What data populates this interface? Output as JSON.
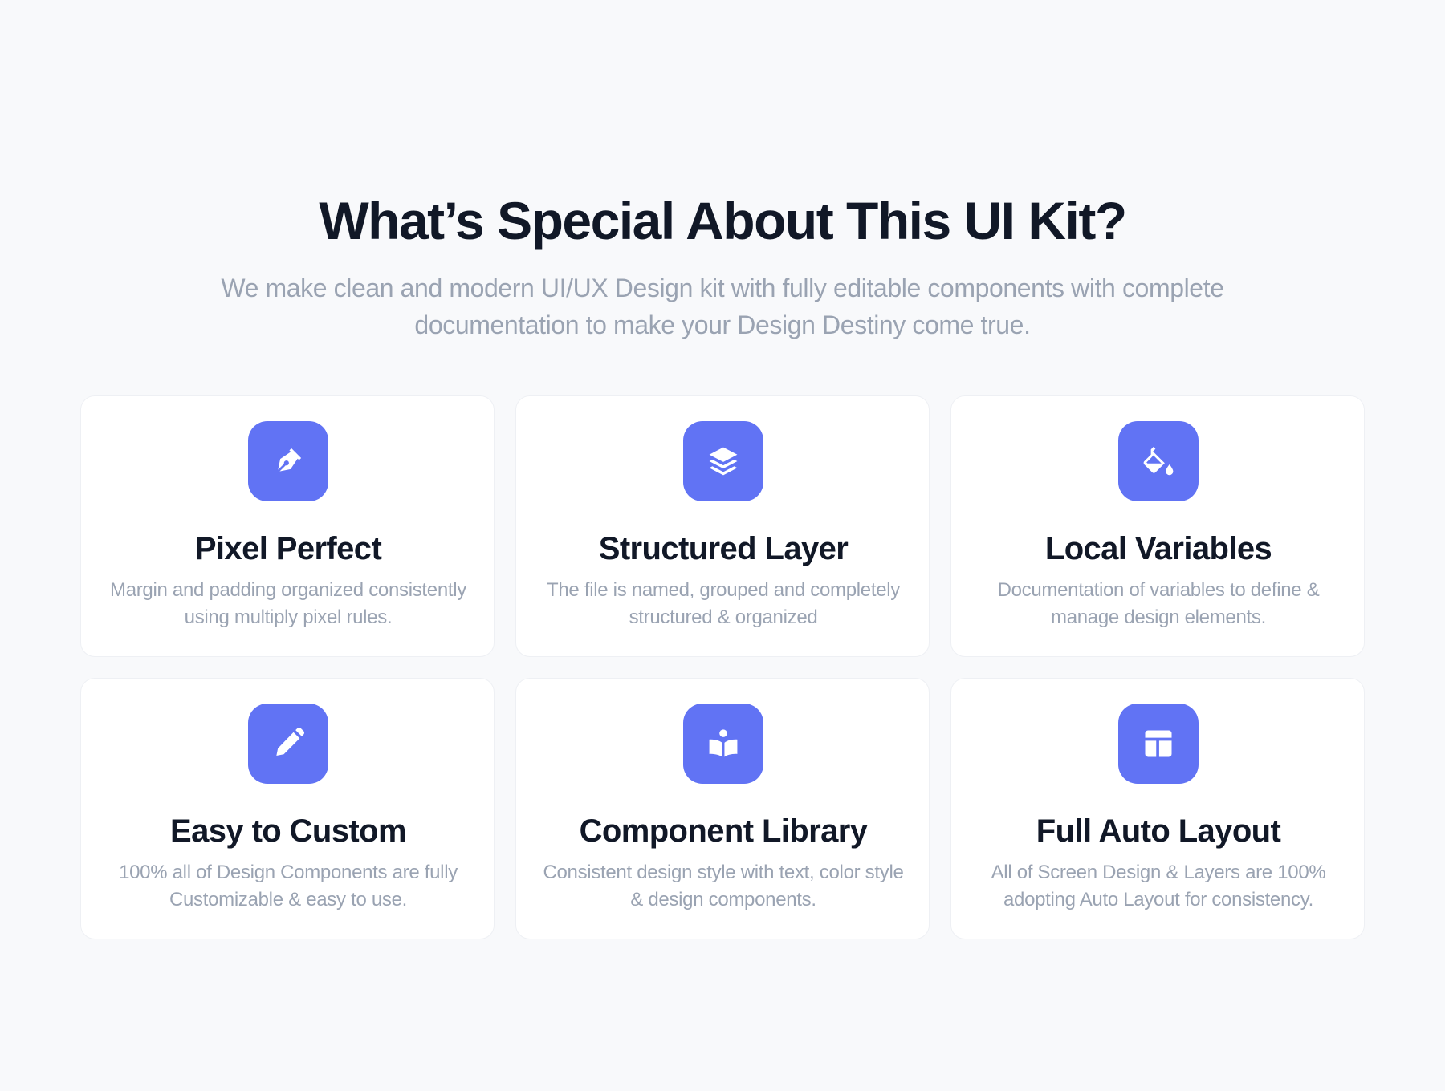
{
  "header": {
    "title": "What’s Special About This UI Kit?",
    "subtitle": "We make clean and modern UI/UX Design kit with fully editable components with complete documentation to make your Design Destiny come true."
  },
  "colors": {
    "accent": "#6173f4",
    "background": "#f8f9fb",
    "card": "#ffffff",
    "title": "#111827",
    "muted": "#9aa3b2"
  },
  "features": [
    {
      "icon": "pen-nib-icon",
      "title": "Pixel Perfect",
      "description": "Margin and padding organized consistently using multiply pixel rules."
    },
    {
      "icon": "layers-icon",
      "title": "Structured Layer",
      "description": "The file is named, grouped and completely structured & organized"
    },
    {
      "icon": "paint-bucket-icon",
      "title": "Local Variables",
      "description": "Documentation of variables to define & manage design elements."
    },
    {
      "icon": "pencil-icon",
      "title": "Easy to Custom",
      "description": "100% all of Design Components are fully Customizable & easy to use."
    },
    {
      "icon": "book-reader-icon",
      "title": "Component Library",
      "description": "Consistent design style with text, color style & design components."
    },
    {
      "icon": "layout-icon",
      "title": "Full Auto Layout",
      "description": "All of Screen Design & Layers are 100% adopting Auto Layout for consistency."
    }
  ]
}
